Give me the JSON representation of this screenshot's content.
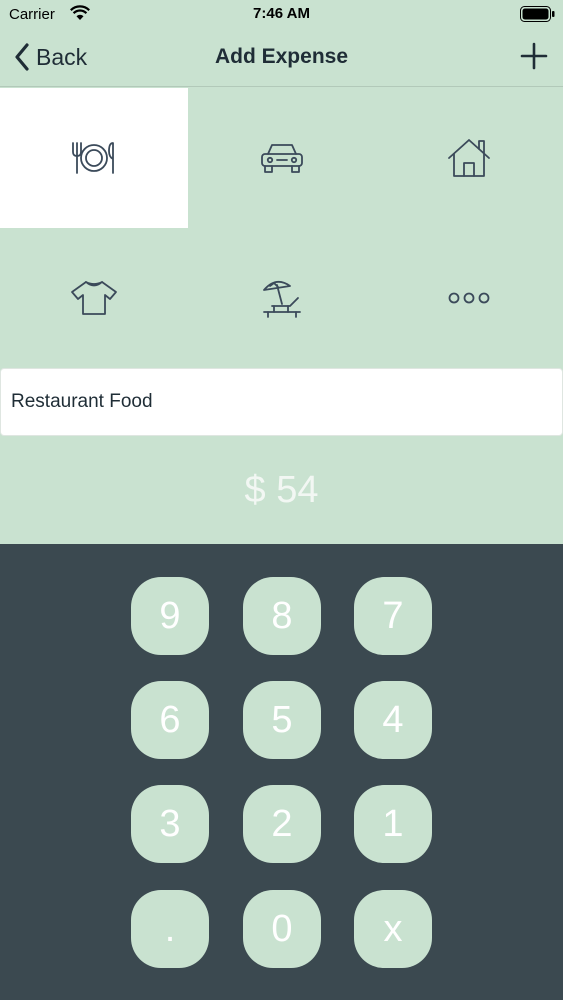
{
  "status_bar": {
    "carrier": "Carrier",
    "time": "7:46 AM"
  },
  "nav": {
    "back_label": "Back",
    "title": "Add Expense",
    "add_icon": "plus-icon"
  },
  "categories": [
    {
      "icon": "restaurant-icon",
      "selected": true
    },
    {
      "icon": "car-icon",
      "selected": false
    },
    {
      "icon": "house-icon",
      "selected": false
    },
    {
      "icon": "shirt-icon",
      "selected": false
    },
    {
      "icon": "beach-icon",
      "selected": false
    },
    {
      "icon": "more-icon",
      "selected": false
    }
  ],
  "expense_name": {
    "value": "Restaurant Food"
  },
  "amount": {
    "display": "$ 54"
  },
  "keypad": {
    "keys": [
      "9",
      "8",
      "7",
      "6",
      "5",
      "4",
      "3",
      "2",
      "1",
      ".",
      "0",
      "x"
    ]
  },
  "colors": {
    "background": "#c9e2d0",
    "keypad_bg": "#3b4950",
    "icon": "#3b4a5a"
  }
}
